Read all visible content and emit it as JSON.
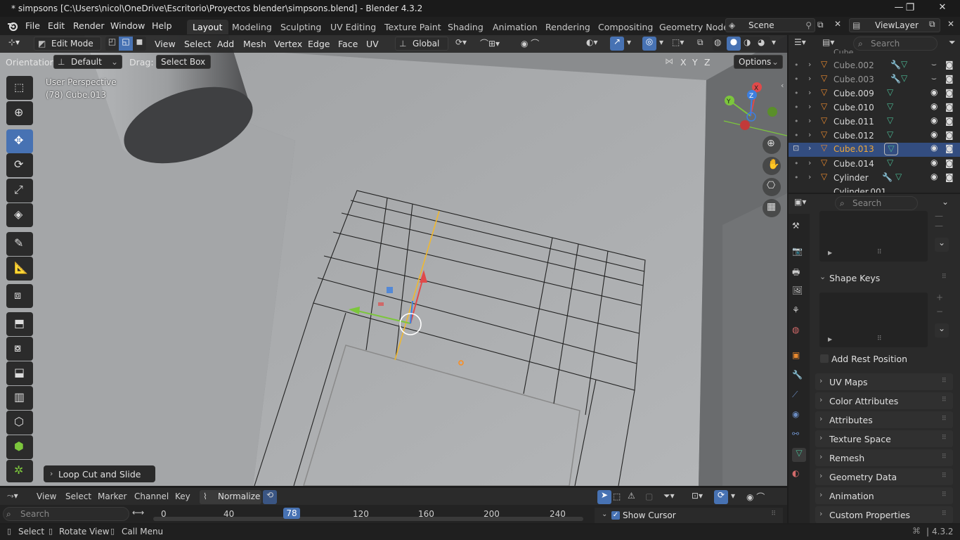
{
  "window": {
    "title": "* simpsons [C:\\Users\\nicol\\OneDrive\\Escritorio\\Proyectos blender\\simpsons.blend] - Blender 4.3.2",
    "controls": [
      "—",
      "❐",
      "✕"
    ]
  },
  "menu": [
    "File",
    "Edit",
    "Render",
    "Window",
    "Help"
  ],
  "workspaces": [
    "Layout",
    "Modeling",
    "Sculpting",
    "UV Editing",
    "Texture Paint",
    "Shading",
    "Animation",
    "Rendering",
    "Compositing",
    "Geometry Node"
  ],
  "active_workspace": "Layout",
  "scene": "Scene",
  "view_layer": "ViewLayer",
  "viewport_header": {
    "mode": "Edit Mode",
    "menus": [
      "View",
      "Select",
      "Add",
      "Mesh",
      "Vertex",
      "Edge",
      "Face",
      "UV"
    ],
    "transform_orientation": "Global",
    "orientation_label": "Orientation:",
    "orientation_value": "Default",
    "drag_label": "Drag:",
    "drag_value": "Select Box",
    "axes": [
      "X",
      "Y",
      "Z"
    ],
    "options": "Options"
  },
  "viewport": {
    "view_name": "User Perspective",
    "object_info": "(78) Cube.013",
    "last_operator": "Loop Cut and Slide",
    "gizmo_axes": [
      "X",
      "Y",
      "Z"
    ]
  },
  "outliner": {
    "search_placeholder": "Search",
    "items": [
      {
        "name": "Cube.002",
        "selected": false,
        "dim": true
      },
      {
        "name": "Cube.003",
        "selected": false,
        "dim": true
      },
      {
        "name": "Cube.009",
        "selected": false,
        "dim": false
      },
      {
        "name": "Cube.010",
        "selected": false,
        "dim": false
      },
      {
        "name": "Cube.011",
        "selected": false,
        "dim": false
      },
      {
        "name": "Cube.012",
        "selected": false,
        "dim": false
      },
      {
        "name": "Cube.013",
        "selected": true,
        "dim": false
      },
      {
        "name": "Cube.014",
        "selected": false,
        "dim": false
      },
      {
        "name": "Cylinder",
        "selected": false,
        "dim": false
      }
    ],
    "partial_top": "Cube",
    "partial_bottom": "Cylinder.001"
  },
  "properties": {
    "search_placeholder": "Search",
    "shape_keys": "Shape Keys",
    "add_rest_position": "Add Rest Position",
    "panels": [
      "UV Maps",
      "Color Attributes",
      "Attributes",
      "Texture Space",
      "Remesh",
      "Geometry Data",
      "Animation",
      "Custom Properties"
    ]
  },
  "timeline": {
    "menus": [
      "View",
      "Select",
      "Marker",
      "Channel",
      "Key"
    ],
    "normalize": "Normalize",
    "search_placeholder": "Search",
    "current_frame": "78",
    "ticks": [
      "0",
      "40",
      "120",
      "160",
      "200",
      "240"
    ],
    "show_cursor": "Show Cursor"
  },
  "statusbar": {
    "items": [
      "Select",
      "Rotate View",
      "Call Menu"
    ],
    "version": "4.3.2"
  },
  "colors": {
    "accent": "#4772b3",
    "selected_row": "#334d80",
    "selected_text": "#f0a838",
    "frame_marker": "#4772b3",
    "axis_x": "#e04a4a",
    "axis_y": "#7cc63c",
    "axis_z": "#3d7fe0",
    "origin": "#ff8c1a"
  }
}
